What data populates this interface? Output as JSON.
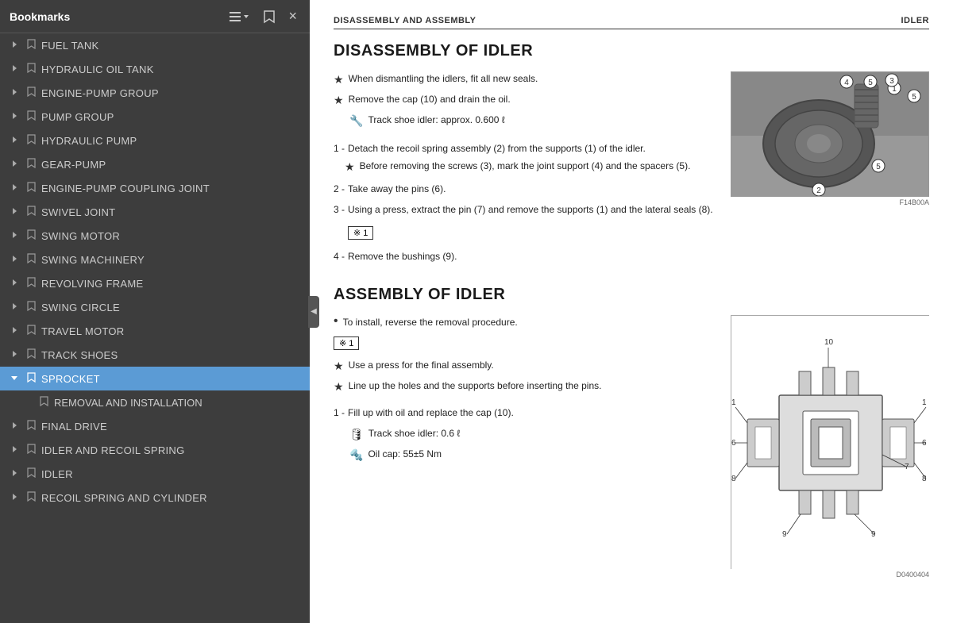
{
  "sidebar": {
    "title": "Bookmarks",
    "close_label": "×",
    "toolbar": {
      "list_icon": "≡▾",
      "bookmark_icon": "🔖"
    },
    "items": [
      {
        "id": "fuel-tank",
        "label": "FUEL TANK",
        "expanded": false,
        "active": false,
        "level": 0
      },
      {
        "id": "hydraulic-oil-tank",
        "label": "HYDRAULIC OIL TANK",
        "expanded": false,
        "active": false,
        "level": 0
      },
      {
        "id": "engine-pump-group",
        "label": "ENGINE-PUMP GROUP",
        "expanded": false,
        "active": false,
        "level": 0
      },
      {
        "id": "pump-group",
        "label": "PUMP GROUP",
        "expanded": false,
        "active": false,
        "level": 0
      },
      {
        "id": "hydraulic-pump",
        "label": "HYDRAULIC PUMP",
        "expanded": false,
        "active": false,
        "level": 0
      },
      {
        "id": "gear-pump",
        "label": "GEAR-PUMP",
        "expanded": false,
        "active": false,
        "level": 0
      },
      {
        "id": "engine-pump-coupling-joint",
        "label": "ENGINE-PUMP COUPLING JOINT",
        "expanded": false,
        "active": false,
        "level": 0
      },
      {
        "id": "swivel-joint",
        "label": "SWIVEL JOINT",
        "expanded": false,
        "active": false,
        "level": 0
      },
      {
        "id": "swing-motor",
        "label": "SWING MOTOR",
        "expanded": false,
        "active": false,
        "level": 0
      },
      {
        "id": "swing-machinery",
        "label": "SWING MACHINERY",
        "expanded": false,
        "active": false,
        "level": 0
      },
      {
        "id": "revolving-frame",
        "label": "REVOLVING FRAME",
        "expanded": false,
        "active": false,
        "level": 0
      },
      {
        "id": "swing-circle",
        "label": "SWING CIRCLE",
        "expanded": false,
        "active": false,
        "level": 0
      },
      {
        "id": "travel-motor",
        "label": "TRAVEL MOTOR",
        "expanded": false,
        "active": false,
        "level": 0
      },
      {
        "id": "track-shoes",
        "label": "TRACK SHOES",
        "expanded": false,
        "active": false,
        "level": 0
      },
      {
        "id": "sprocket",
        "label": "SPROCKET",
        "expanded": true,
        "active": true,
        "level": 0
      },
      {
        "id": "removal-installation",
        "label": "REMOVAL AND INSTALLATION",
        "expanded": false,
        "active": false,
        "level": 1
      },
      {
        "id": "final-drive",
        "label": "FINAL DRIVE",
        "expanded": false,
        "active": false,
        "level": 0
      },
      {
        "id": "idler-recoil-spring",
        "label": "IDLER AND RECOIL SPRING",
        "expanded": false,
        "active": false,
        "level": 0
      },
      {
        "id": "idler",
        "label": "IDLER",
        "expanded": false,
        "active": false,
        "level": 0
      },
      {
        "id": "recoil-spring-cylinder",
        "label": "RECOIL SPRING AND CYLINDER",
        "expanded": false,
        "active": false,
        "level": 0
      }
    ]
  },
  "main": {
    "header_left": "DISASSEMBLY AND ASSEMBLY",
    "header_right": "IDLER",
    "disassembly_title": "DISASSEMBLY OF IDLER",
    "assembly_title": "ASSEMBLY OF IDLER",
    "disassembly_bullets": [
      "When dismantling the idlers, fit all new seals.",
      "Remove the cap (10) and drain the oil."
    ],
    "track_shoe_idler_approx": "Track shoe idler: approx. 0.600 ℓ",
    "num_items": [
      {
        "num": "1",
        "text": "Detach the recoil spring assembly (2) from the supports (1) of the idler.",
        "sub": "Before removing the screws (3), mark the joint support (4) and the spacers (5)."
      },
      {
        "num": "2",
        "text": "Take away the pins (6).",
        "sub": ""
      },
      {
        "num": "3",
        "text": "Using a press, extract the pin (7) and remove the supports (1) and the lateral seals (8).",
        "sub": ""
      },
      {
        "num": "4",
        "text": "Remove the bushings (9).",
        "sub": ""
      }
    ],
    "note_label": "※ 1",
    "assembly_bullets": [
      "To install, reverse the removal procedure."
    ],
    "assembly_note": "※ 1",
    "assembly_note2": "Use a press for the final assembly.",
    "assembly_note3": "Line up the holes and the supports before inserting the pins.",
    "assembly_num_items": [
      {
        "num": "1",
        "text": "Fill up with oil and replace the cap (10)."
      }
    ],
    "track_shoe_idler_fill": "Track shoe idler: 0.6 ℓ",
    "oil_cap_torque": "Oil cap: 55±5 Nm",
    "photo_caption": "F14B00A",
    "diagram_caption": "D0400404"
  }
}
